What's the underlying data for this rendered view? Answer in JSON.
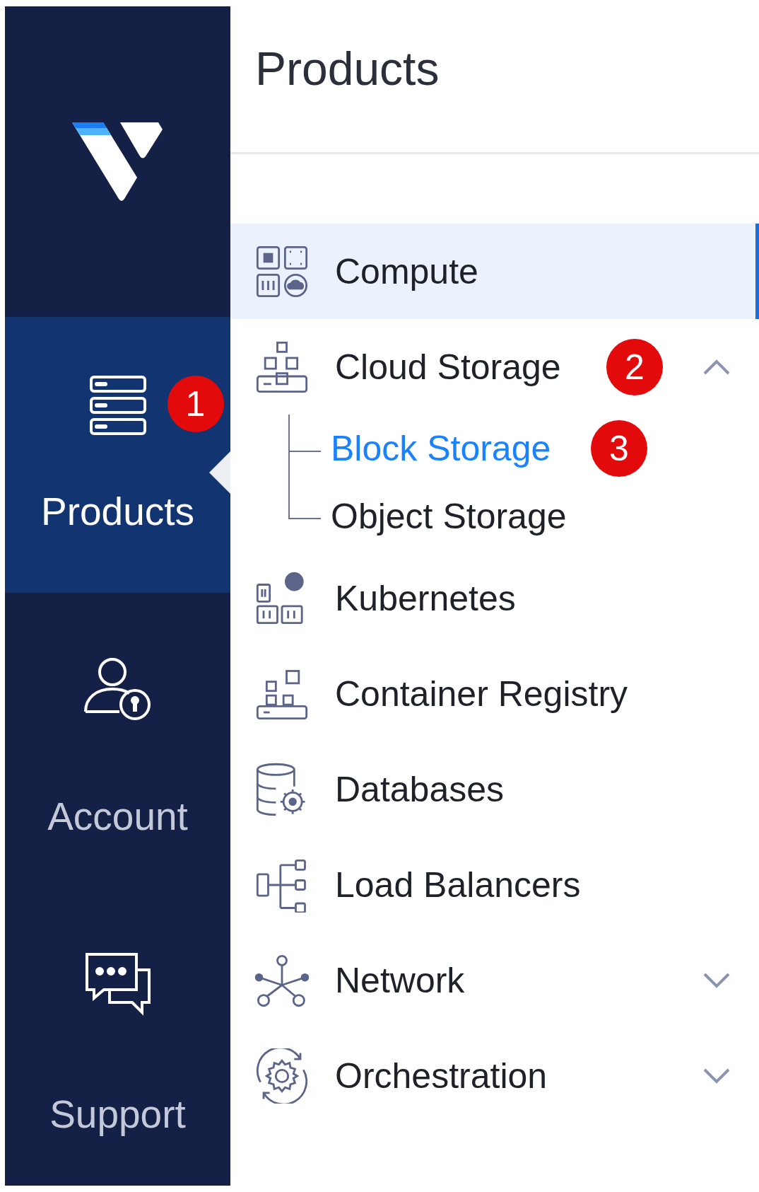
{
  "rail": {
    "items": [
      {
        "label": "Products",
        "selected": true,
        "badge": "1"
      },
      {
        "label": "Account",
        "selected": false
      },
      {
        "label": "Support",
        "selected": false
      }
    ]
  },
  "panel": {
    "title": "Products",
    "items": [
      {
        "label": "Compute",
        "selected": true
      },
      {
        "label": "Cloud Storage",
        "selected": false,
        "expanded": true,
        "badge": "2",
        "children": [
          {
            "label": "Block Storage",
            "selected": true,
            "badge": "3"
          },
          {
            "label": "Object Storage",
            "selected": false
          }
        ]
      },
      {
        "label": "Kubernetes",
        "selected": false
      },
      {
        "label": "Container Registry",
        "selected": false
      },
      {
        "label": "Databases",
        "selected": false
      },
      {
        "label": "Load Balancers",
        "selected": false
      },
      {
        "label": "Network",
        "selected": false,
        "expanded": false
      },
      {
        "label": "Orchestration",
        "selected": false,
        "expanded": false
      }
    ]
  }
}
